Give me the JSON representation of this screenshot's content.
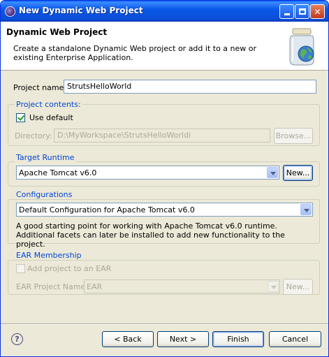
{
  "window": {
    "title": "New Dynamic Web Project"
  },
  "banner": {
    "title": "Dynamic Web Project",
    "description": "Create a standalone Dynamic Web project or add it to a new or existing Enterprise Application."
  },
  "project_name": {
    "label": "Project name:",
    "value": "StrutsHelloWorld"
  },
  "project_contents": {
    "group_label": "Project contents:",
    "use_default_label": "Use default",
    "use_default_checked": true,
    "directory_label": "Directory:",
    "directory_value": "D:\\MyWorkspace\\StrutsHelloWorldi",
    "browse_label": "Browse..."
  },
  "target_runtime": {
    "group_label": "Target Runtime",
    "selected": "Apache Tomcat v6.0",
    "new_label": "New..."
  },
  "configurations": {
    "group_label": "Configurations",
    "selected": "Default Configuration for Apache Tomcat v6.0",
    "description": "A good starting point for working with Apache Tomcat v6.0 runtime. Additional facets can later be installed to add new functionality to the project."
  },
  "ear_membership": {
    "group_label": "EAR Membership",
    "add_label": "Add project to an EAR",
    "add_checked": false,
    "ear_name_label": "EAR Project Name:",
    "ear_name_value": "EAR",
    "new_label": "New..."
  },
  "footer": {
    "help_icon": "help-icon",
    "back_label": "< Back",
    "next_label": "Next >",
    "finish_label": "Finish",
    "cancel_label": "Cancel"
  }
}
